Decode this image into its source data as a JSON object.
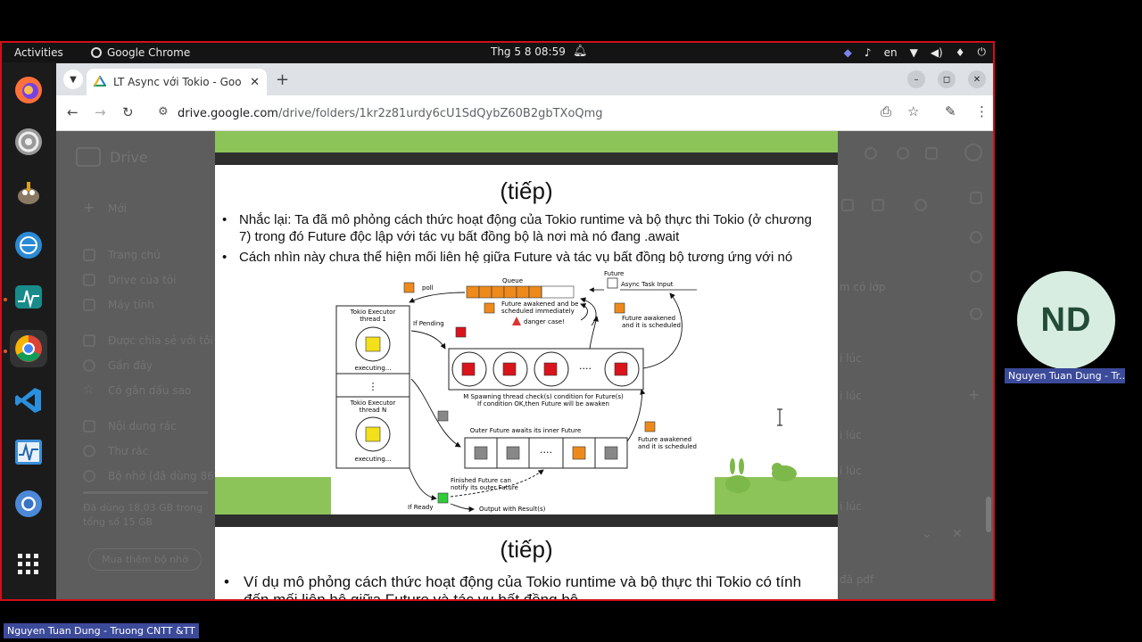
{
  "topbar": {
    "activities": "Activities",
    "app_name": "Google Chrome",
    "clock": "Thg 5 8  08:59",
    "language": "en"
  },
  "dock": {
    "items": [
      "firefox-icon",
      "settings-icon",
      "gimp-icon",
      "network-icon",
      "monitor-icon",
      "chrome-icon",
      "vscode-icon",
      "system-monitor-icon",
      "chromium-icon",
      "app-grid-icon"
    ]
  },
  "browser": {
    "tab_title": "LT Async với Tokio - Goo",
    "url_host": "drive.google.com",
    "url_path": "/drive/folders/1kr2z81urdy6cU1SdQybZ60B2gbTXoQmg"
  },
  "drive": {
    "logo_text": "Drive",
    "new_label": "Mới",
    "nav": [
      "Trang chủ",
      "Drive của tôi",
      "Máy tính",
      "Được chia sẻ với tôi",
      "Gần đây",
      "Có gắn dấu sao",
      "Nội dung rác",
      "Thư rác",
      "Bộ nhớ (đã dùng 86%)"
    ],
    "storage_note": [
      "Đã dùng 18,03 GB trong",
      "tổng số 15 GB"
    ],
    "buy_storage": "Mua thêm bộ nhớ",
    "right_items": [
      "m có lớp",
      "i lúc",
      "i lúc",
      "i lúc",
      "i lúc",
      "i lúc",
      "i lúc",
      "đã pdf"
    ]
  },
  "slide1": {
    "title": "(tiếp)",
    "bullets": [
      "Nhắc lại: Ta đã mô phỏng cách thức hoạt động của Tokio runtime và bộ thực thi Tokio (ở chương 7) trong đó Future độc lập với tác vụ bất đồng bộ là nơi mà nó đang .await",
      "Cách nhìn này chưa thể hiện mối liên hệ giữa Future và tác vụ bất đồng bộ tương ứng với nó"
    ]
  },
  "diagram": {
    "poll": "poll",
    "queue": "Queue",
    "future": "Future",
    "async_task_input": "Async Task Input",
    "future_awakened_immediately_1": "Future awakened and be",
    "future_awakened_immediately_2": "scheduled immediately",
    "danger_case": "danger case!",
    "future_awakened_scheduled_1": "Future awakened",
    "future_awakened_scheduled_2": "and it is scheduled",
    "executor_thread_1a": "Tokio Executor",
    "executor_thread_1b": "thread 1",
    "executor_thread_na": "Tokio Executor",
    "executor_thread_nb": "thread N",
    "executing": "executing...",
    "if_pending": "If Pending",
    "spawning_1": "M Spawning thread check(s) condition for Future(s)",
    "spawning_2": "If condition OK,then Future will be awaken",
    "outer_future": "Outer Future awaits its inner Future",
    "finished_1": "Finished Future can",
    "finished_2": "notify its outer Future",
    "if_ready": "If Ready",
    "output": "Output with Result(s)",
    "dots": "····"
  },
  "slide2": {
    "title": "(tiếp)",
    "bullet": "Ví dụ mô phỏng cách thức hoạt động của Tokio runtime và bộ thực thi Tokio có tính đến mối liên hệ giữa Future và tác vụ bất đồng bộ"
  },
  "meeting": {
    "initials": "ND",
    "participant_label": "Nguyen Tuan Dung - Tr...",
    "presenter_label": "Nguyen Tuan Dung - Truong CNTT &TT"
  },
  "colors": {
    "frame": "#d0101a",
    "slide_green": "#8dc45a",
    "label_bg": "#3c4a9a",
    "avatar_bg": "#d8ede1"
  }
}
